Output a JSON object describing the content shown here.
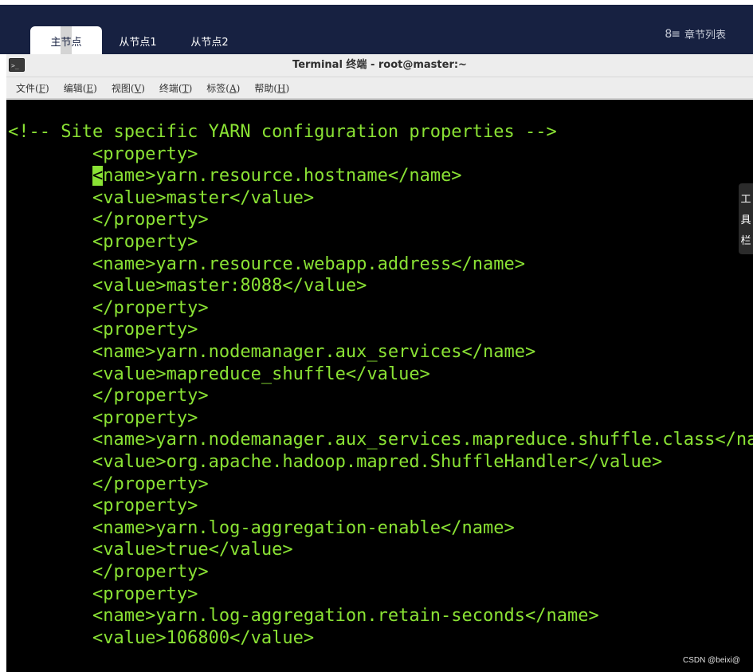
{
  "tabs": [
    {
      "label": "主节点"
    },
    {
      "label": "从节点1"
    },
    {
      "label": "从节点2"
    }
  ],
  "chapter_list": {
    "icon": "list-icon",
    "label": "章节列表"
  },
  "window": {
    "title": "Terminal 终端 - root@master:~",
    "icon_text": ">_"
  },
  "menu": [
    {
      "label": "文件",
      "key": "F"
    },
    {
      "label": "编辑",
      "key": "E"
    },
    {
      "label": "视图",
      "key": "V"
    },
    {
      "label": "终端",
      "key": "T"
    },
    {
      "label": "标签",
      "key": "A"
    },
    {
      "label": "帮助",
      "key": "H"
    }
  ],
  "terminal": {
    "text_color": "#8ae234",
    "background": "#000000",
    "comment": "<!-- Site specific YARN configuration properties -->",
    "lines": [
      "        <property>",
      "        <name>yarn.resource.hostname</name>",
      "        <value>master</value>",
      "        </property>",
      "        <property>",
      "        <name>yarn.resource.webapp.address</name>",
      "        <value>master:8088</value>",
      "        </property>",
      "        <property>",
      "        <name>yarn.nodemanager.aux_services</name>",
      "        <value>mapreduce_shuffle</value>",
      "        </property>",
      "        <property>",
      "        <name>yarn.nodemanager.aux_services.mapreduce.shuffle.class</name>",
      "        <value>org.apache.hadoop.mapred.ShuffleHandler</value>",
      "        </property>",
      "        <property>",
      "        <name>yarn.log-aggregation-enable</name>",
      "        <value>true</value>",
      "        </property>",
      "        <property>",
      "        <name>yarn.log-aggregation.retain-seconds</name>",
      "        <value>106800</value>"
    ],
    "cursor_line": 1
  },
  "side_toolbar": {
    "chars": [
      "工",
      "具",
      "栏"
    ]
  },
  "watermark": "CSDN @beixi@"
}
